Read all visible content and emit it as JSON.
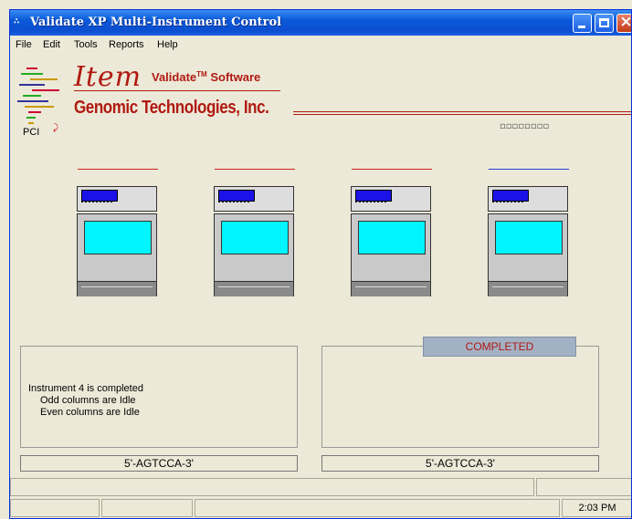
{
  "window": {
    "title": "Validate XP Multi-Instrument Control",
    "app_icon": "∴"
  },
  "menu": [
    "File",
    "Edit",
    "Tools",
    "Reports",
    "Help"
  ],
  "brand": {
    "item": "Item",
    "validate": "Validate",
    "trademark": "TM",
    "software": "Software",
    "company": "Genomic Technologies, Inc.",
    "pci": "PCI",
    "indicator_dots": "▫▫▫▫▫▫▫▫"
  },
  "instruments": [
    {
      "line_color": "#d02020"
    },
    {
      "line_color": "#d02020"
    },
    {
      "line_color": "#d02020"
    },
    {
      "line_color": "#2040d0"
    }
  ],
  "left_panel": {
    "line1": "Instrument 4 is completed",
    "line2": "Odd columns are Idle",
    "line3": "Even columns are Idle",
    "sequence": "5'-AGTCCA-3'"
  },
  "right_panel": {
    "status": "COMPLETED",
    "sequence": "5'-AGTCCA-3'"
  },
  "statusbar": {
    "time": "2:03 PM"
  },
  "colors": {
    "brand_red": "#b01a12",
    "screen_cyan": "#00f5ff",
    "display_blue": "#1b12e8",
    "titlebar_blue": "#0a58d8"
  }
}
